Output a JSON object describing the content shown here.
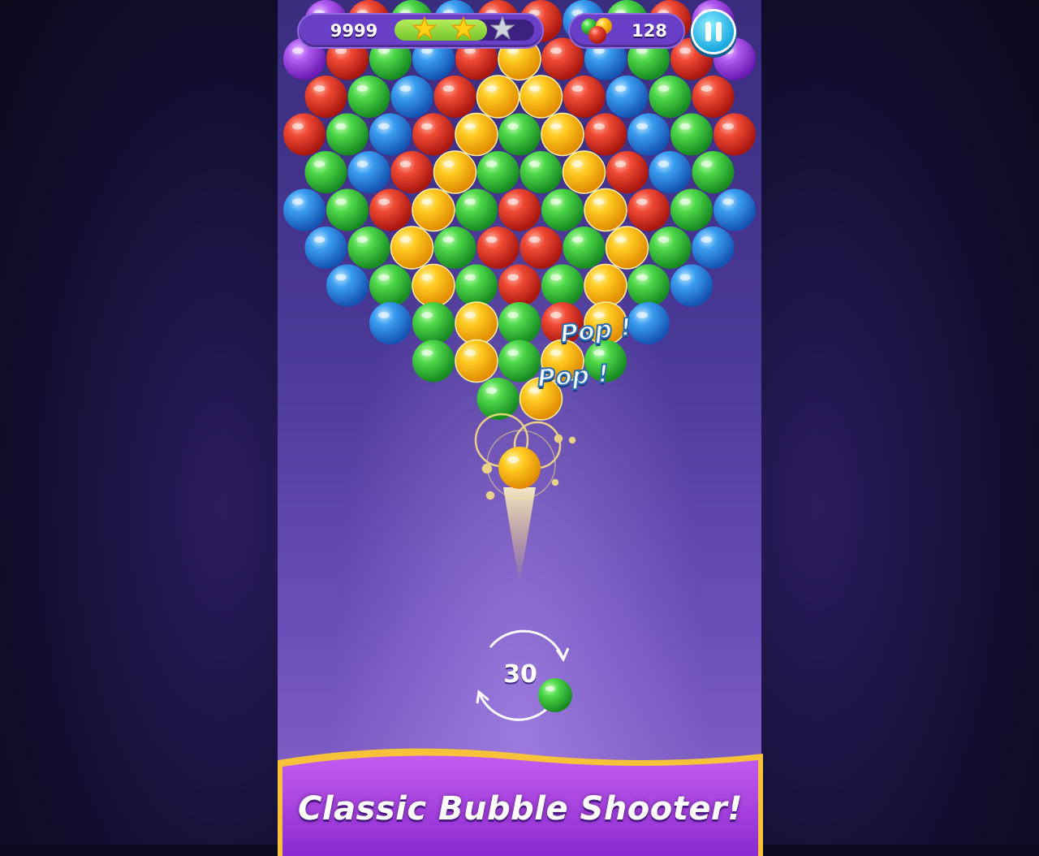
{
  "hud": {
    "score": "9999",
    "progress_fraction": 0.66,
    "stars_earned": 2,
    "stars_total": 3,
    "coins": "128"
  },
  "icons": {
    "pause": "pause-icon",
    "coins": "bubble-cluster-icon",
    "star": "star-icon",
    "swap": "swap-arrows-icon"
  },
  "colors": {
    "red": "#e8352a",
    "green": "#3fcf4a",
    "blue": "#2b8fe8",
    "yellow": "#ffc21a",
    "purple": "#a24ee8"
  },
  "board": {
    "rows": [
      "PRGBRRBGRP",
      "PRGBRYRBGRP",
      "RGBRYYRBGR",
      "RGBRYGYRBGR",
      "GBRYGGYRBG",
      "BGRYGRGYRGB",
      "BGYGRRGYGB",
      "BGYGRGYGB",
      "BGYGRYB",
      "GYGYG",
      "GY"
    ]
  },
  "popups": [
    "Pop !",
    "Pop !"
  ],
  "shooter": {
    "current_color": "yellow",
    "next_color": "green",
    "moves_left": "30"
  },
  "banner": {
    "text": "Classic Bubble Shooter!"
  }
}
